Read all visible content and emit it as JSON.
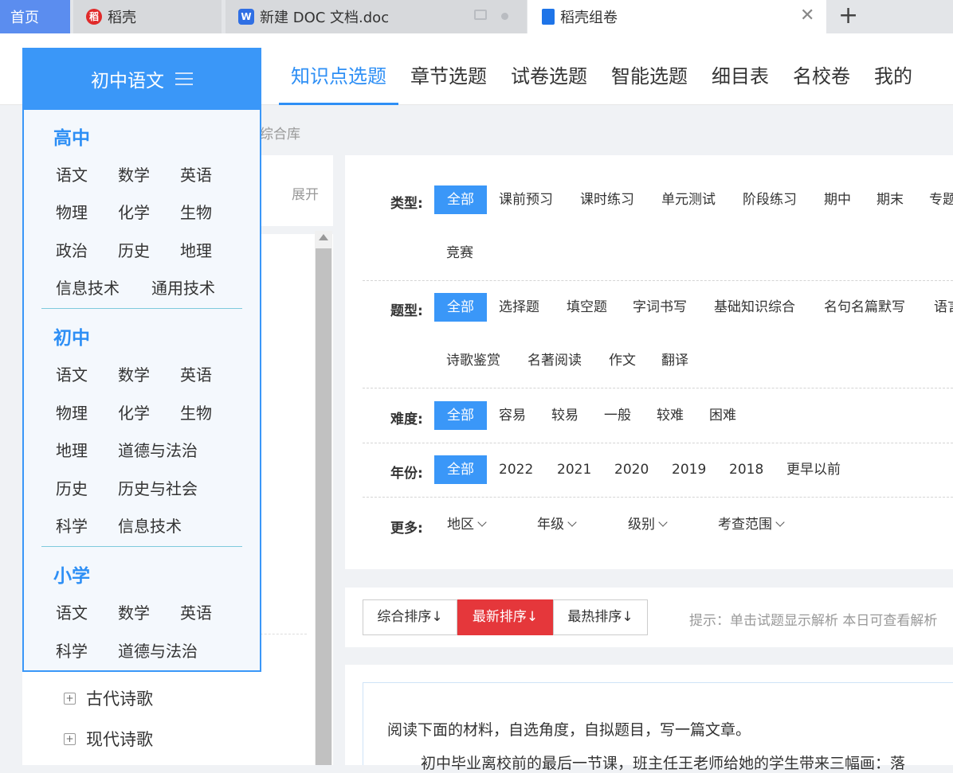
{
  "tabs": {
    "home": "首页",
    "tab1": "稻壳",
    "tab2": "新建 DOC 文档.doc",
    "tab3": "稻壳组卷"
  },
  "nav": [
    "知识点选题",
    "章节选题",
    "试卷选题",
    "智能选题",
    "细目表",
    "名校卷",
    "我的"
  ],
  "breadcrumb_tail": "综合库",
  "expand_label": "展开",
  "dropdown": {
    "current": "初中语文",
    "sections": [
      {
        "name": "高中",
        "subjects": [
          "语文",
          "数学",
          "英语",
          "物理",
          "化学",
          "生物",
          "政治",
          "历史",
          "地理",
          "信息技术",
          "通用技术"
        ]
      },
      {
        "name": "初中",
        "subjects": [
          "语文",
          "数学",
          "英语",
          "物理",
          "化学",
          "生物",
          "地理",
          "道德与法治",
          "历史",
          "历史与社会",
          "科学",
          "信息技术"
        ]
      },
      {
        "name": "小学",
        "subjects": [
          "语文",
          "数学",
          "英语",
          "科学",
          "道德与法治"
        ]
      }
    ]
  },
  "tree": [
    "古代诗歌",
    "现代诗歌"
  ],
  "filters": {
    "type": {
      "label": "类型:",
      "options": [
        "全部",
        "课前预习",
        "课时练习",
        "单元测试",
        "阶段练习",
        "期中",
        "期末",
        "专题",
        "竞赛"
      ]
    },
    "qtype": {
      "label": "题型:",
      "options": [
        "全部",
        "选择题",
        "填空题",
        "字词书写",
        "基础知识综合",
        "名句名篇默写",
        "语言",
        "诗歌鉴赏",
        "名著阅读",
        "作文",
        "翻译"
      ]
    },
    "difficulty": {
      "label": "难度:",
      "options": [
        "全部",
        "容易",
        "较易",
        "一般",
        "较难",
        "困难"
      ]
    },
    "year": {
      "label": "年份:",
      "options": [
        "全部",
        "2022",
        "2021",
        "2020",
        "2019",
        "2018",
        "更早以前"
      ]
    },
    "more": {
      "label": "更多:",
      "options": [
        "地区",
        "年级",
        "级别",
        "考查范围"
      ]
    }
  },
  "sort": {
    "buttons": [
      "综合排序↓",
      "最新排序↓",
      "最热排序↓"
    ],
    "hint": "提示：单击试题显示解析 本日可查看解析"
  },
  "question": {
    "line1": "阅读下面的材料，自选角度，自拟题目，写一篇文章。",
    "line2": "初中毕业离校前的最后一节课，班主任王老师给她的学生带来三幅画：落"
  },
  "colors": {
    "accent": "#3a97f8",
    "sort_active": "#e5373b"
  }
}
